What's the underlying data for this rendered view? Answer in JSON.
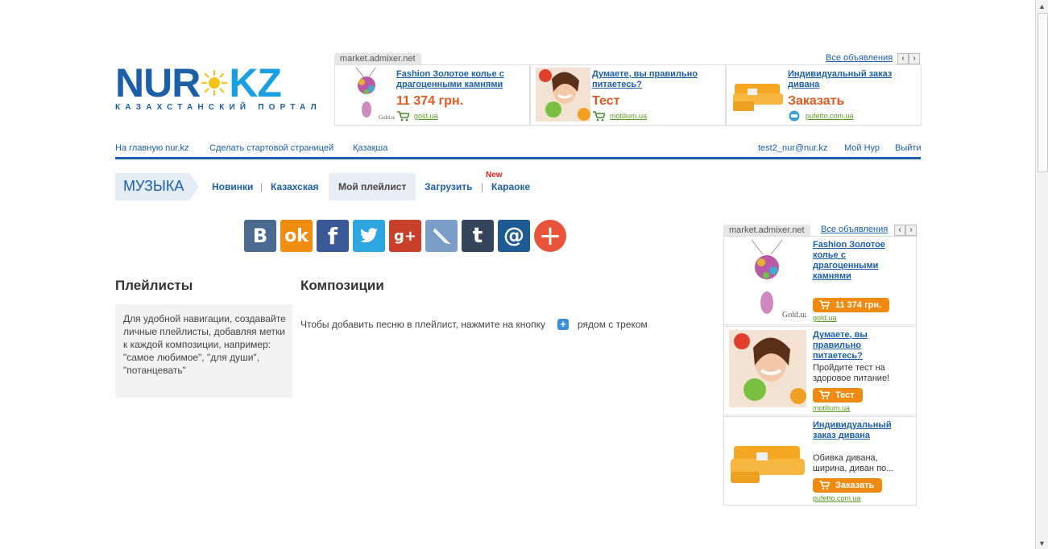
{
  "logo": {
    "part1": "NUR",
    "part2": "KZ",
    "tagline": "КАЗАХСТАНСКИЙ ПОРТАЛ"
  },
  "top_ad": {
    "source": "market.admixer.net",
    "all_link": "Все объявления",
    "items": [
      {
        "title": "Fashion Золотое колье с драгоценными камнями",
        "price": "11 374 грн.",
        "domain": "gold.ua"
      },
      {
        "title": "Думаете, вы правильно питаетесь?",
        "price": "Тест",
        "domain": "motilium.ua"
      },
      {
        "title": "Индивидуальный заказ дивана",
        "price": "Заказать",
        "domain": "pufetto.com.ua"
      }
    ]
  },
  "topnav": {
    "home": "На главную nur.kz",
    "start_page": "Сделать стартовой страницей",
    "kazakh": "Қазақша",
    "email": "test2_nur@nur.kz",
    "my_nur": "Мой Нур",
    "logout": "Выйти"
  },
  "section": {
    "title": "МУЗЫКА",
    "tabs": [
      "Новинки",
      "Казахская",
      "Мой плейлист",
      "Загрузить",
      "Караоке"
    ],
    "new_badge": "New"
  },
  "share_buttons": [
    "vk",
    "odnoklassniki",
    "facebook",
    "twitter",
    "google-plus",
    "livejournal",
    "tumblr",
    "mail",
    "more"
  ],
  "playlists": {
    "title": "Плейлисты",
    "info": "Для удобной навигации, создавайте личные плейлисты, добавляя метки к каждой композиции, например: \"самое любимое\", \"для души\", \"потанцевать\""
  },
  "compositions": {
    "title": "Композиции",
    "hint_before": "Чтобы добавить песню в плейлист, нажмите на кнопку",
    "hint_after": "рядом с треком"
  },
  "side_ad": {
    "source": "market.admixer.net",
    "all_link": "Все объявления",
    "items": [
      {
        "title": "Fashion Золотое колье с драгоценными камнями",
        "desc": "",
        "button": "11 374 грн.",
        "domain": "gold.ua"
      },
      {
        "title": "Думаете, вы правильно питаетесь?",
        "desc": "Пройдите тест на здоровое питание!",
        "button": "Тест",
        "domain": "motilium.ua"
      },
      {
        "title": "Индивидуальный заказ дивана",
        "desc": "Обивка дивана, ширина, диван по...",
        "button": "Заказать",
        "domain": "pufetto.com.ua"
      }
    ]
  },
  "colors": {
    "brand_blue": "#1a5fa8",
    "price_orange": "#e05a20",
    "button_orange": "#f08a10"
  }
}
